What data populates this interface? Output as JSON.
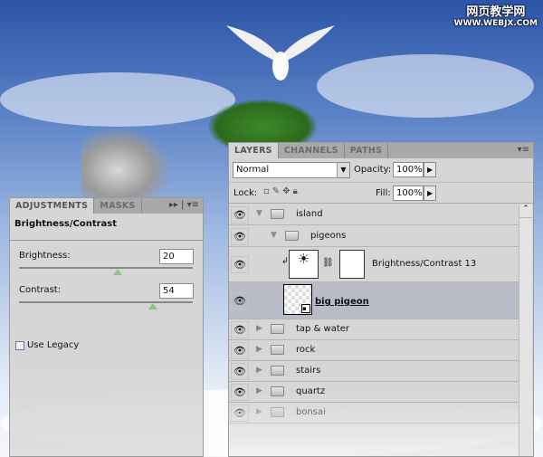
{
  "watermark": {
    "line1": "网页教学网",
    "line2": "WWW.WEBJX.COM"
  },
  "adjustments": {
    "tabs": [
      {
        "label": "ADJUSTMENTS",
        "active": true
      },
      {
        "label": "MASKS",
        "active": false
      }
    ],
    "title": "Brightness/Contrast",
    "brightness": {
      "label": "Brightness:",
      "value": 20,
      "min": -150,
      "max": 150
    },
    "contrast": {
      "label": "Contrast:",
      "value": 54,
      "min": -100,
      "max": 100
    },
    "use_legacy": {
      "label": "Use Legacy",
      "checked": false
    }
  },
  "layers": {
    "tabs": [
      {
        "label": "LAYERS",
        "active": true
      },
      {
        "label": "CHANNELS",
        "active": false
      },
      {
        "label": "PATHS",
        "active": false
      }
    ],
    "blend_mode": "Normal",
    "opacity_label": "Opacity:",
    "opacity": "100%",
    "lock_label": "Lock:",
    "fill_label": "Fill:",
    "fill": "100%",
    "items": [
      {
        "name": "island",
        "type": "group",
        "expanded": true
      },
      {
        "name": "pigeons",
        "type": "group",
        "expanded": true
      },
      {
        "name": "Brightness/Contrast 13",
        "type": "adjustment"
      },
      {
        "name": "big pigeon",
        "type": "smart-object",
        "selected": true
      },
      {
        "name": "tap & water",
        "type": "group",
        "expanded": false
      },
      {
        "name": "rock",
        "type": "group",
        "expanded": false
      },
      {
        "name": "stairs",
        "type": "group",
        "expanded": false
      },
      {
        "name": "quartz",
        "type": "group",
        "expanded": false
      },
      {
        "name": "bonsai",
        "type": "group",
        "expanded": false
      }
    ]
  },
  "colors": {
    "panel": "#d6d6d6",
    "selected_row": "#b9bbc7",
    "slider_thumb": "#a9d6a9"
  }
}
